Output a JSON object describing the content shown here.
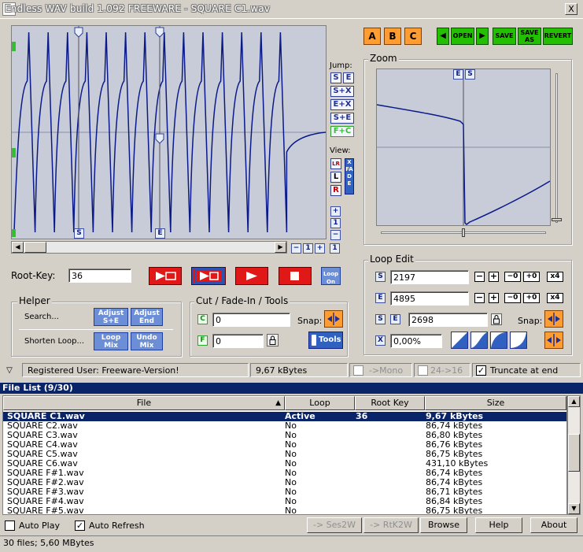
{
  "window": {
    "title": "Endless WAV build 1.092 FREEWARE - SQUARE C1.wav",
    "close": "X"
  },
  "toolbar": {
    "slots": [
      "A",
      "B",
      "C"
    ],
    "open": "OPEN",
    "save": "SAVE",
    "save_as": "SAVE AS",
    "revert": "REVERT",
    "prev": "◀",
    "next": "▶"
  },
  "wave": {
    "markers": {
      "start": "S",
      "end": "E"
    },
    "zoom_controls": [
      "−",
      "1",
      "+",
      "1"
    ]
  },
  "jump": {
    "label": "Jump:",
    "s": "S",
    "e": "E",
    "s_plus_x": "S+X",
    "e_plus_x": "E+X",
    "s_plus_e": "S+E",
    "f_plus_c": "F+C"
  },
  "view": {
    "label": "View:",
    "lr": "LR",
    "l": "L",
    "r": "R",
    "xfade": "XFADE",
    "zoom_side": [
      "+",
      "1",
      "−",
      "1"
    ]
  },
  "zoom": {
    "title": "Zoom",
    "marker_e": "E",
    "marker_s": "S"
  },
  "root_key": {
    "label": "Root-Key:",
    "value": "36"
  },
  "transport": {
    "loop_on": "Loop On"
  },
  "loop_edit": {
    "title": "Loop Edit",
    "start_label": "S",
    "start_value": "2197",
    "end_label": "E",
    "end_value": "4895",
    "len_s": "S",
    "len_e": "E",
    "length_value": "2698",
    "x_label": "X",
    "x_value": "0,00%",
    "snap": "Snap:",
    "minus": "−",
    "plus": "+",
    "minus0": "−0",
    "plus0": "+0",
    "x4": "x4"
  },
  "helper": {
    "title": "Helper",
    "search_label": "Search...",
    "adjust_se": "Adjust S+E",
    "adjust_end": "Adjust End",
    "shorten_label": "Shorten Loop...",
    "loop_mix": "Loop Mix",
    "undo_mix": "Undo Mix"
  },
  "cut": {
    "title": "Cut / Fade-In / Tools",
    "c_label": "C",
    "c_value": "0",
    "f_label": "F",
    "f_value": "0",
    "snap": "Snap:",
    "tools": "Tools"
  },
  "status": {
    "user": "Registered User: Freeware-Version!",
    "size": "9,67 kBytes",
    "mono": "->Mono",
    "bits": "24->16",
    "truncate": "Truncate at end"
  },
  "file_list": {
    "title": "File List (9/30)",
    "columns": [
      "File",
      "Loop",
      "Root Key",
      "Size"
    ],
    "rows": [
      {
        "file": "SQUARE C1.wav",
        "loop": "Active",
        "key": "36",
        "size": "9,67 kBytes",
        "selected": true
      },
      {
        "file": "SQUARE C2.wav",
        "loop": "No",
        "key": "",
        "size": "86,74 kBytes"
      },
      {
        "file": "SQUARE C3.wav",
        "loop": "No",
        "key": "",
        "size": "86,80 kBytes"
      },
      {
        "file": "SQUARE C4.wav",
        "loop": "No",
        "key": "",
        "size": "86,76 kBytes"
      },
      {
        "file": "SQUARE C5.wav",
        "loop": "No",
        "key": "",
        "size": "86,75 kBytes"
      },
      {
        "file": "SQUARE C6.wav",
        "loop": "No",
        "key": "",
        "size": "431,10 kBytes"
      },
      {
        "file": "SQUARE F#1.wav",
        "loop": "No",
        "key": "",
        "size": "86,74 kBytes"
      },
      {
        "file": "SQUARE F#2.wav",
        "loop": "No",
        "key": "",
        "size": "86,74 kBytes"
      },
      {
        "file": "SQUARE F#3.wav",
        "loop": "No",
        "key": "",
        "size": "86,71 kBytes"
      },
      {
        "file": "SQUARE F#4.wav",
        "loop": "No",
        "key": "",
        "size": "86,84 kBytes"
      },
      {
        "file": "SQUARE F#5.wav",
        "loop": "No",
        "key": "",
        "size": "86,75 kBytes"
      }
    ]
  },
  "bottom": {
    "auto_play": "Auto Play",
    "auto_refresh": "Auto Refresh",
    "ses2w": "-> Ses2W",
    "rtk2w": "-> RtK2W",
    "browse": "Browse",
    "help": "Help",
    "about": "About",
    "summary": "30 files; 5,60 MBytes"
  }
}
